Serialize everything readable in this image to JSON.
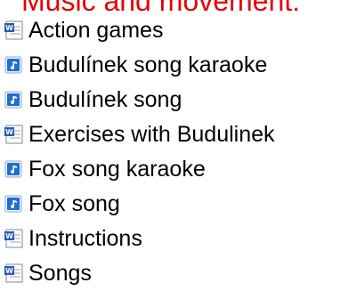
{
  "heading": "Music and movement:",
  "files": [
    {
      "name": "Action games",
      "icon": "word-document-icon"
    },
    {
      "name": "Budulínek song karaoke",
      "icon": "audio-file-icon"
    },
    {
      "name": "Budulínek song",
      "icon": "audio-file-icon"
    },
    {
      "name": "Exercises with Budulinek",
      "icon": "word-document-icon"
    },
    {
      "name": "Fox song karaoke",
      "icon": "audio-file-icon"
    },
    {
      "name": "Fox song",
      "icon": "audio-file-icon"
    },
    {
      "name": "Instructions",
      "icon": "word-document-icon"
    },
    {
      "name": "Songs",
      "icon": "word-document-icon"
    }
  ],
  "colors": {
    "heading": "#e60000",
    "word_blue": "#2b58b5",
    "audio_blue": "#1f6fd1"
  }
}
